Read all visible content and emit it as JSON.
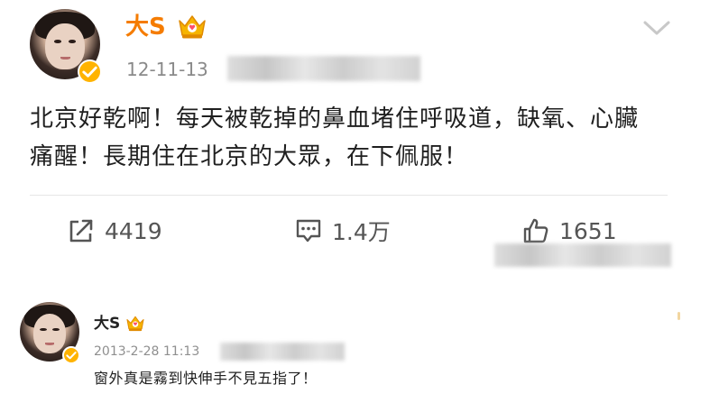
{
  "post": {
    "author": "大S",
    "time": "12-11-13",
    "text": "北京好乾啊！每天被乾掉的鼻血堵住呼吸道，缺氧、心臟痛醒！長期住在北京的大眾，在下佩服！",
    "actions": {
      "repost_count": "4419",
      "comment_count": "1.4万",
      "like_count": "1651"
    }
  },
  "reply": {
    "author": "大S",
    "time": "2013-2-28 11:13",
    "text": "窗外真是霧到快伸手不見五指了！"
  },
  "icons": {
    "post_badge": "verified-badge-icon",
    "crown": "crown-icon",
    "menu": "chevron-down-icon",
    "repost": "repost-icon",
    "comment": "comment-icon",
    "like": "thumbs-up-icon"
  },
  "colors": {
    "name_orange": "#f57c00",
    "verified_yellow": "#ffb300",
    "meta_gray": "#8a8a8a",
    "divider": "#e6e6e6"
  }
}
